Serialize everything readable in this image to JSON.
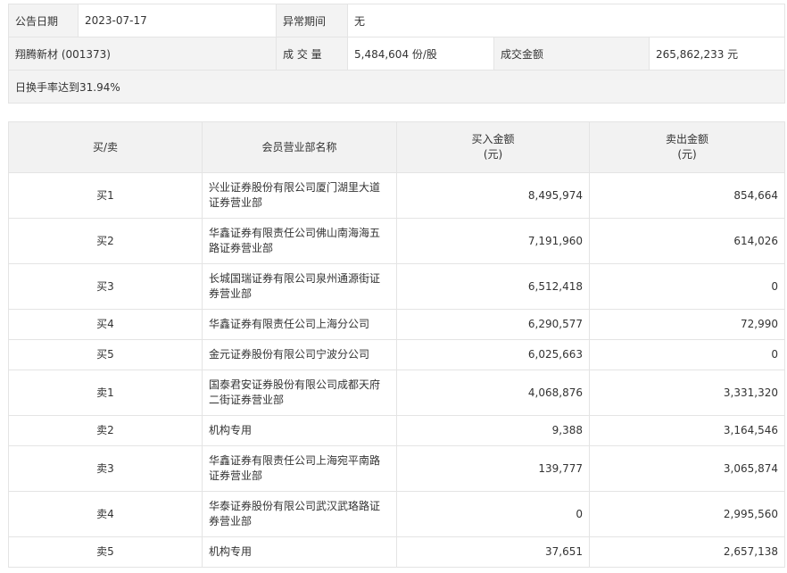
{
  "summary": {
    "date_label": "公告日期",
    "date_value": "2023-07-17",
    "abnormal_label": "异常期间",
    "abnormal_value": "无",
    "stock_name": "翔腾新材 (001373)",
    "volume_label": "成 交 量",
    "volume_value": "5,484,604 份/股",
    "amount_label": "成交金额",
    "amount_value": "265,862,233 元",
    "reason": "日换手率达到31.94%"
  },
  "table": {
    "headers": {
      "side": "买/卖",
      "dept": "会员营业部名称",
      "buy_l1": "买入金额",
      "buy_l2": "(元)",
      "sell_l1": "卖出金额",
      "sell_l2": "(元)"
    },
    "rows": [
      {
        "side": "买1",
        "dept": "兴业证券股份有限公司厦门湖里大道证券营业部",
        "buy": "8,495,974",
        "sell": "854,664"
      },
      {
        "side": "买2",
        "dept": "华鑫证券有限责任公司佛山南海海五路证券营业部",
        "buy": "7,191,960",
        "sell": "614,026"
      },
      {
        "side": "买3",
        "dept": "长城国瑞证券有限公司泉州通源街证券营业部",
        "buy": "6,512,418",
        "sell": "0"
      },
      {
        "side": "买4",
        "dept": "华鑫证券有限责任公司上海分公司",
        "buy": "6,290,577",
        "sell": "72,990"
      },
      {
        "side": "买5",
        "dept": "金元证券股份有限公司宁波分公司",
        "buy": "6,025,663",
        "sell": "0"
      },
      {
        "side": "卖1",
        "dept": "国泰君安证券股份有限公司成都天府二街证券营业部",
        "buy": "4,068,876",
        "sell": "3,331,320"
      },
      {
        "side": "卖2",
        "dept": "机构专用",
        "buy": "9,388",
        "sell": "3,164,546"
      },
      {
        "side": "卖3",
        "dept": "华鑫证券有限责任公司上海宛平南路证券营业部",
        "buy": "139,777",
        "sell": "3,065,874"
      },
      {
        "side": "卖4",
        "dept": "华泰证券股份有限公司武汉武珞路证券营业部",
        "buy": "0",
        "sell": "2,995,560"
      },
      {
        "side": "卖5",
        "dept": "机构专用",
        "buy": "37,651",
        "sell": "2,657,138"
      }
    ]
  }
}
